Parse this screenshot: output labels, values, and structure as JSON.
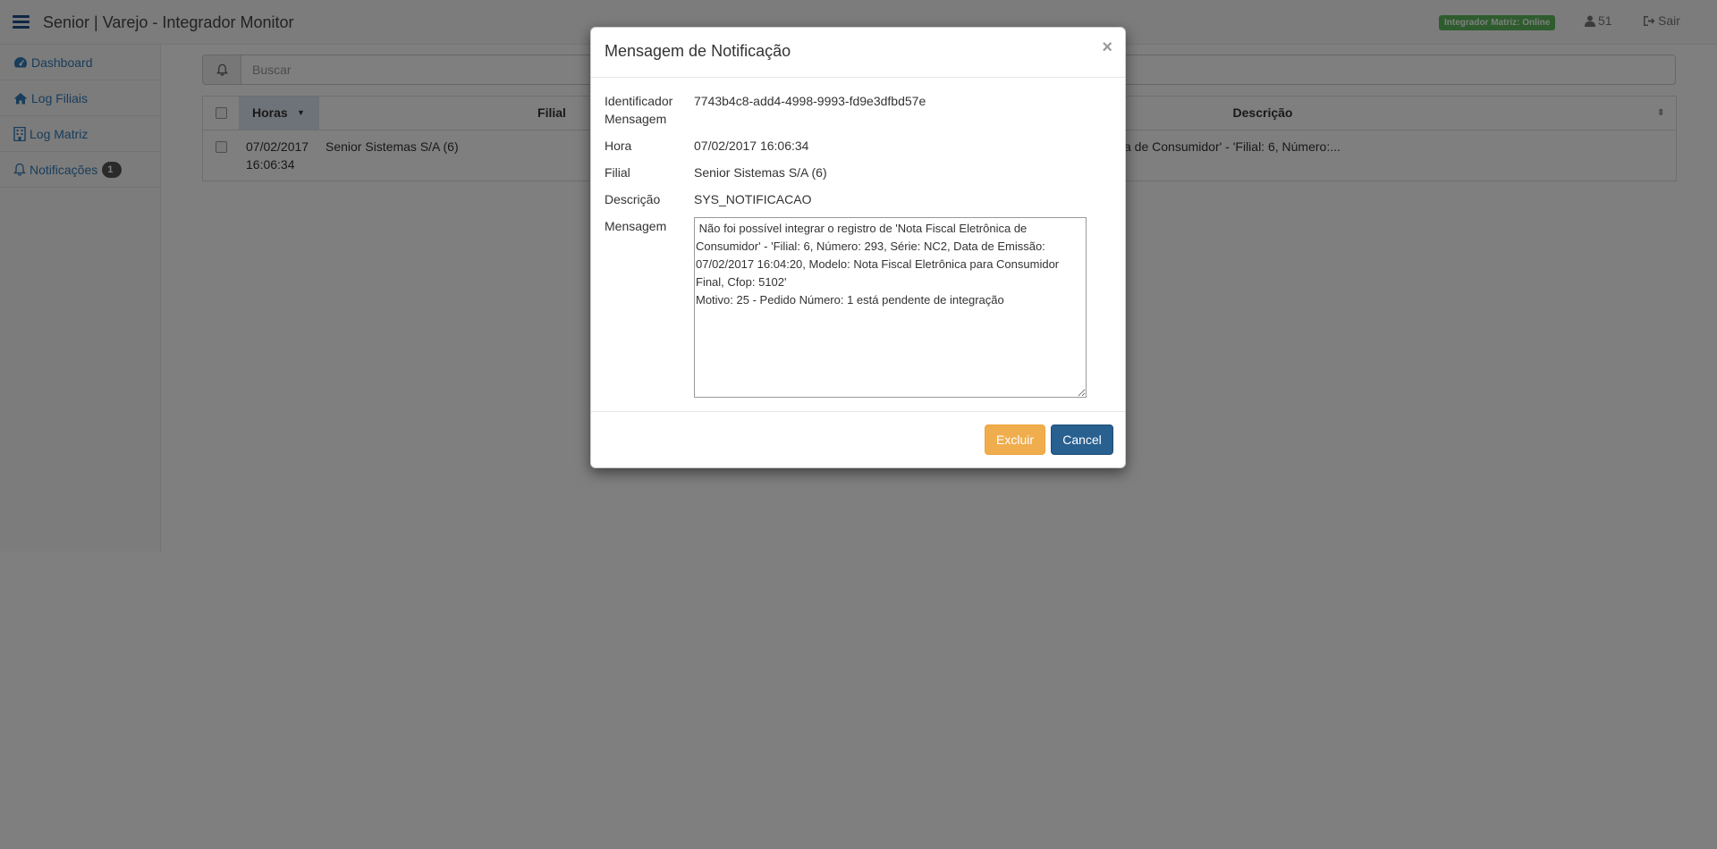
{
  "navbar": {
    "brand": "Senior | Varejo - Integrador Monitor",
    "status_badge": "Integrador Matriz: Online",
    "user_count": "51",
    "logout_label": "Sair"
  },
  "sidebar": {
    "items": [
      {
        "label": "Dashboard",
        "icon": "dashboard-icon"
      },
      {
        "label": "Log Filiais",
        "icon": "home-icon"
      },
      {
        "label": "Log Matriz",
        "icon": "building-icon"
      },
      {
        "label": "Notificações",
        "icon": "bell-icon",
        "badge": "1"
      }
    ]
  },
  "search": {
    "placeholder": "Buscar",
    "icon": "bell-icon"
  },
  "grid": {
    "columns": [
      "Horas",
      "Filial",
      "Descrição"
    ],
    "sorted_column": "Horas",
    "rows": [
      {
        "date": "07/02/2017",
        "time": "16:06:34",
        "filial": "Senior Sistemas S/A (6)",
        "descricao": "a de Consumidor' - 'Filial: 6, Número:..."
      }
    ]
  },
  "modal": {
    "title": "Mensagem de Notificação",
    "close_glyph": "×",
    "fields": {
      "identificador_label_1": "Identificador",
      "identificador_label_2": "Mensagem",
      "identificador_value": "7743b4c8-add4-4998-9993-fd9e3dfbd57e",
      "hora_label": "Hora",
      "hora_value": "07/02/2017 16:06:34",
      "filial_label": "Filial",
      "filial_value": "Senior Sistemas S/A (6)",
      "descricao_label": "Descrição",
      "descricao_value": "SYS_NOTIFICACAO",
      "mensagem_label": "Mensagem",
      "mensagem_value": " Não foi possível integrar o registro de 'Nota Fiscal Eletrônica de Consumidor' - 'Filial: 6, Número: 293, Série: NC2, Data de Emissão: 07/02/2017 16:04:20, Modelo: Nota Fiscal Eletrônica para Consumidor Final, Cfop: 5102'\nMotivo: 25 - Pedido Número: 1 está pendente de integração"
    },
    "buttons": {
      "delete": "Excluir",
      "cancel": "Cancel"
    }
  },
  "colors": {
    "status_badge": "#5cb85c",
    "delete_button": "#f0ad4e",
    "cancel_button": "#286090",
    "link": "#337ab7"
  }
}
